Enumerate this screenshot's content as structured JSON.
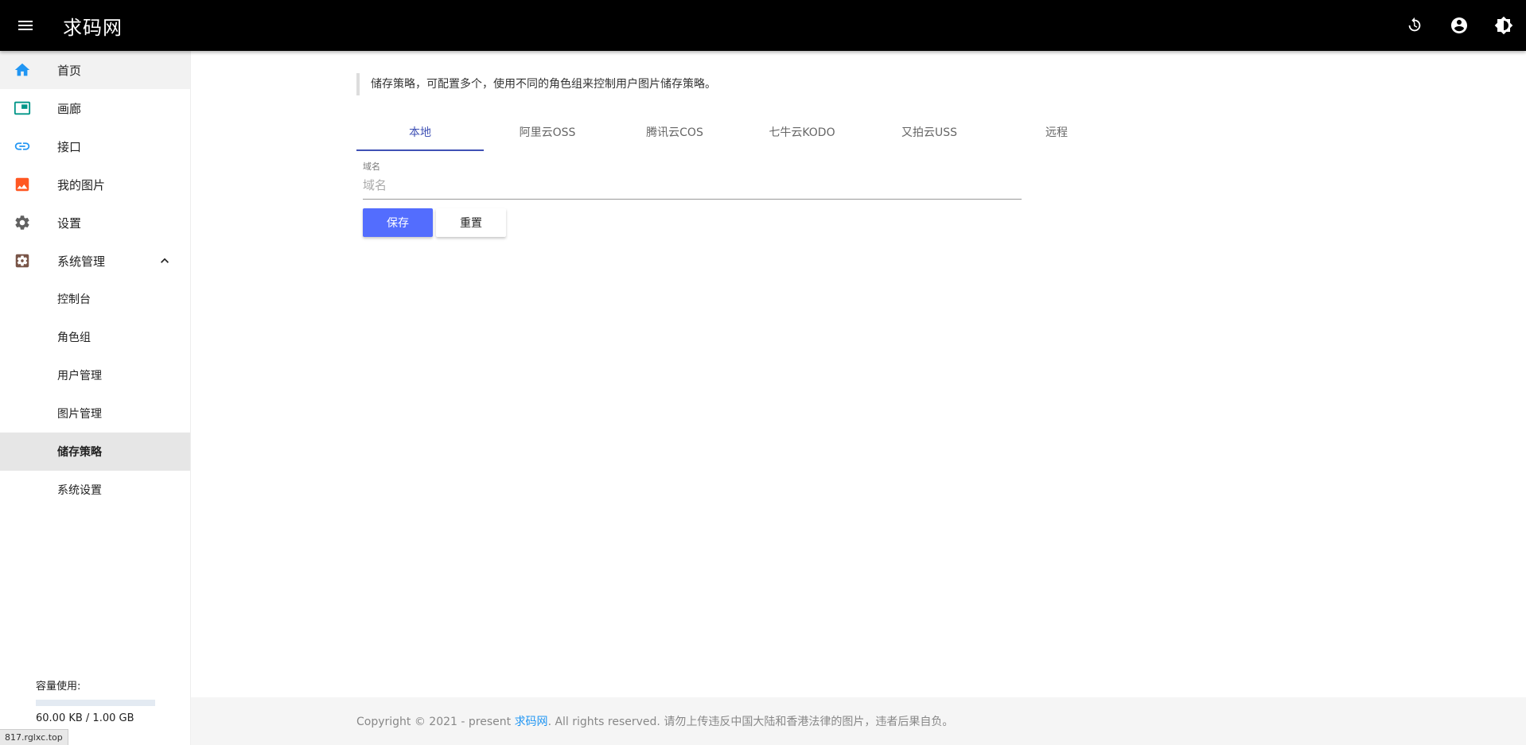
{
  "header": {
    "brand": "求码网",
    "menu_icon": "menu-icon",
    "actions": [
      "refresh-icon",
      "account-icon",
      "theme-icon"
    ]
  },
  "sidebar": {
    "items": [
      {
        "label": "首页",
        "icon": "home-icon",
        "color": "#2196f3"
      },
      {
        "label": "画廊",
        "icon": "gallery-icon",
        "color": "#009688"
      },
      {
        "label": "接口",
        "icon": "link-icon",
        "color": "#2196f3"
      },
      {
        "label": "我的图片",
        "icon": "image-icon",
        "color": "#ff5722"
      },
      {
        "label": "设置",
        "icon": "gear-icon",
        "color": "#616161"
      },
      {
        "label": "系统管理",
        "icon": "admin-settings-icon",
        "color": "#795548"
      }
    ],
    "sub_items": [
      "控制台",
      "角色组",
      "用户管理",
      "图片管理",
      "储存策略",
      "系统设置"
    ],
    "selected_sub": "储存策略"
  },
  "usage": {
    "title": "容量使用:",
    "text": "60.00 KB / 1.00 GB",
    "fraction": 0.0001
  },
  "status_url": "817.rglxc.top",
  "main": {
    "note": "储存策略，可配置多个，使用不同的角色组来控制用户图片储存策略。",
    "tabs": [
      "本地",
      "阿里云OSS",
      "腾讯云COS",
      "七牛云KODO",
      "又拍云USS",
      "远程"
    ],
    "active_tab": "本地",
    "field": {
      "label": "域名",
      "placeholder": "域名",
      "value": ""
    },
    "buttons": {
      "save": "保存",
      "reset": "重置"
    }
  },
  "footer": {
    "prefix": "Copyright © 2021 - present ",
    "link": "求码网",
    "suffix": ". All rights reserved. 请勿上传违反中国大陆和香港法律的图片，违者后果自负。"
  },
  "colors": {
    "header_bg": "#000000",
    "accent": "#3f51b5",
    "primary_button": "#536dfe",
    "link": "#2196f3"
  }
}
